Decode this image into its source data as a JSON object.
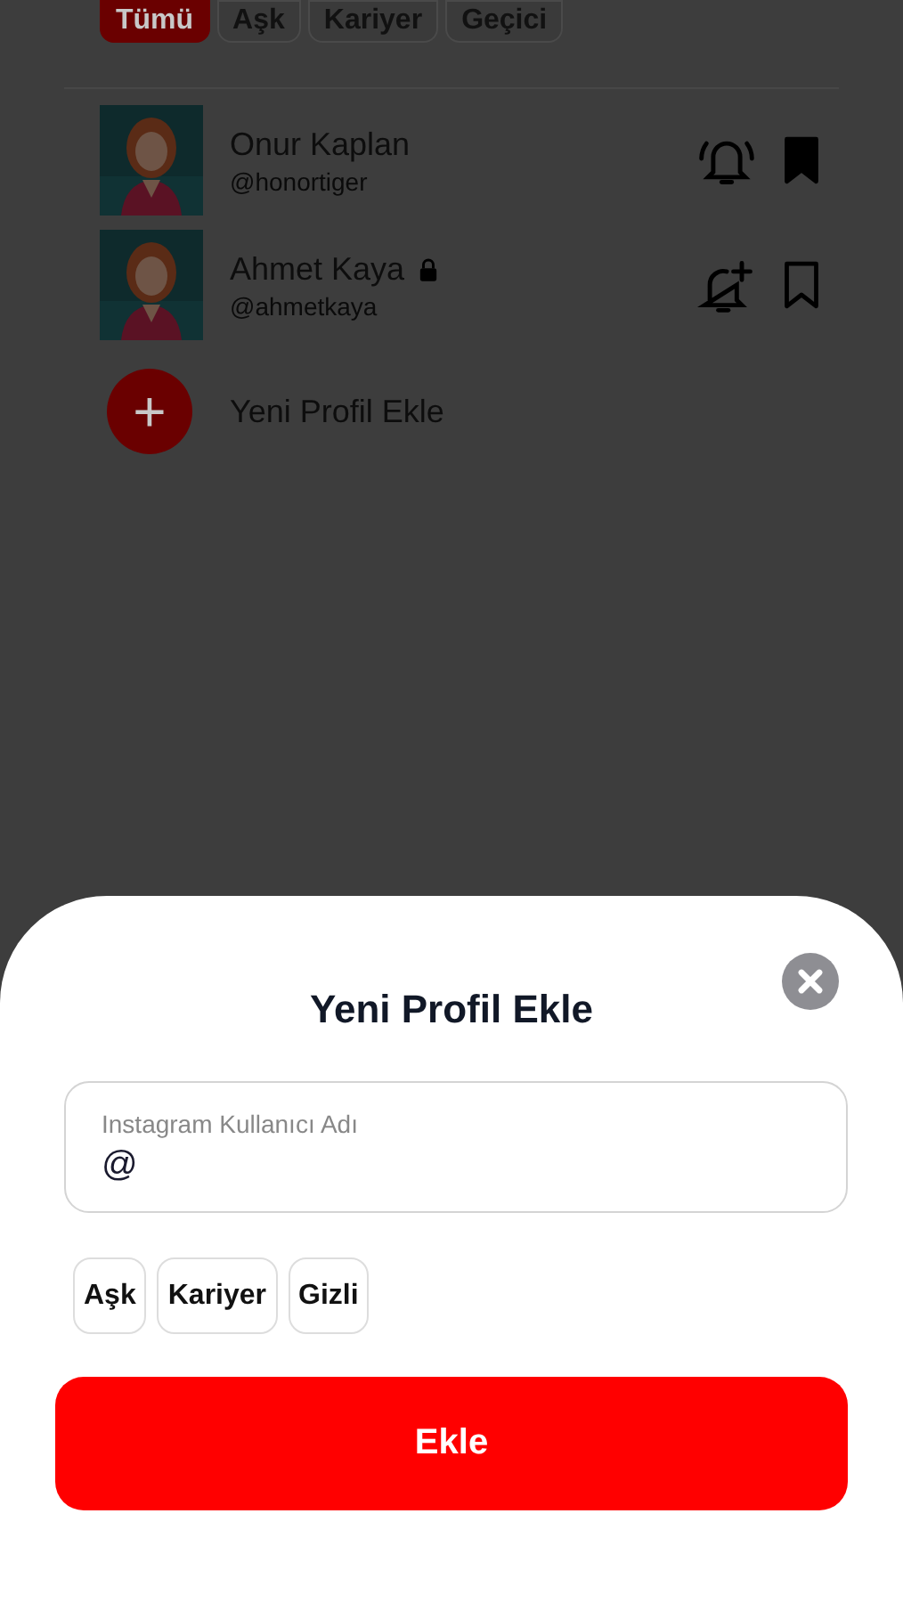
{
  "filter_chips": [
    {
      "label": "Tümü",
      "selected": true
    },
    {
      "label": "Aşk",
      "selected": false
    },
    {
      "label": "Kariyer",
      "selected": false
    },
    {
      "label": "Geçici",
      "selected": false
    }
  ],
  "profiles": [
    {
      "name": "Onur Kaplan",
      "handle": "@honortiger",
      "locked": false,
      "notifications_on": true,
      "saved": true
    },
    {
      "name": "Ahmet Kaya",
      "handle": "@ahmetkaya",
      "locked": true,
      "notifications_on": false,
      "saved": false
    }
  ],
  "add_profile": {
    "label": "Yeni Profil Ekle",
    "icon": "+"
  },
  "sheet": {
    "title": "Yeni Profil Ekle",
    "field": {
      "label": "Instagram Kullanıcı Adı",
      "value": "@"
    },
    "tags": [
      {
        "label": "Aşk",
        "selected": false
      },
      {
        "label": "Kariyer",
        "selected": false
      },
      {
        "label": "Gizli",
        "selected": false
      }
    ],
    "submit": "Ekle"
  }
}
